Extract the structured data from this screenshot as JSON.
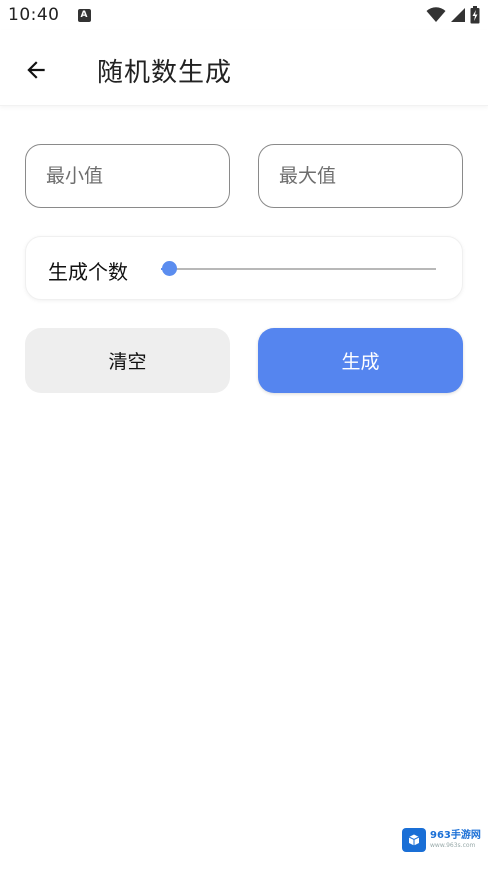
{
  "status_bar": {
    "time": "10:40",
    "notification_icon": "A",
    "icons": [
      "wifi-icon",
      "signal-icon",
      "battery-icon"
    ]
  },
  "app_bar": {
    "title": "随机数生成",
    "back_icon": "arrow-left-icon"
  },
  "inputs": {
    "min": {
      "placeholder": "最小值",
      "value": ""
    },
    "max": {
      "placeholder": "最大值",
      "value": ""
    }
  },
  "slider": {
    "label": "生成个数",
    "level_fraction": 0.03,
    "accent": "#5b8def"
  },
  "buttons": {
    "clear_label": "清空",
    "generate_label": "生成",
    "generate_color": "#5585ef"
  },
  "watermark": {
    "brand": "963手游网",
    "url": "www.963s.com"
  }
}
